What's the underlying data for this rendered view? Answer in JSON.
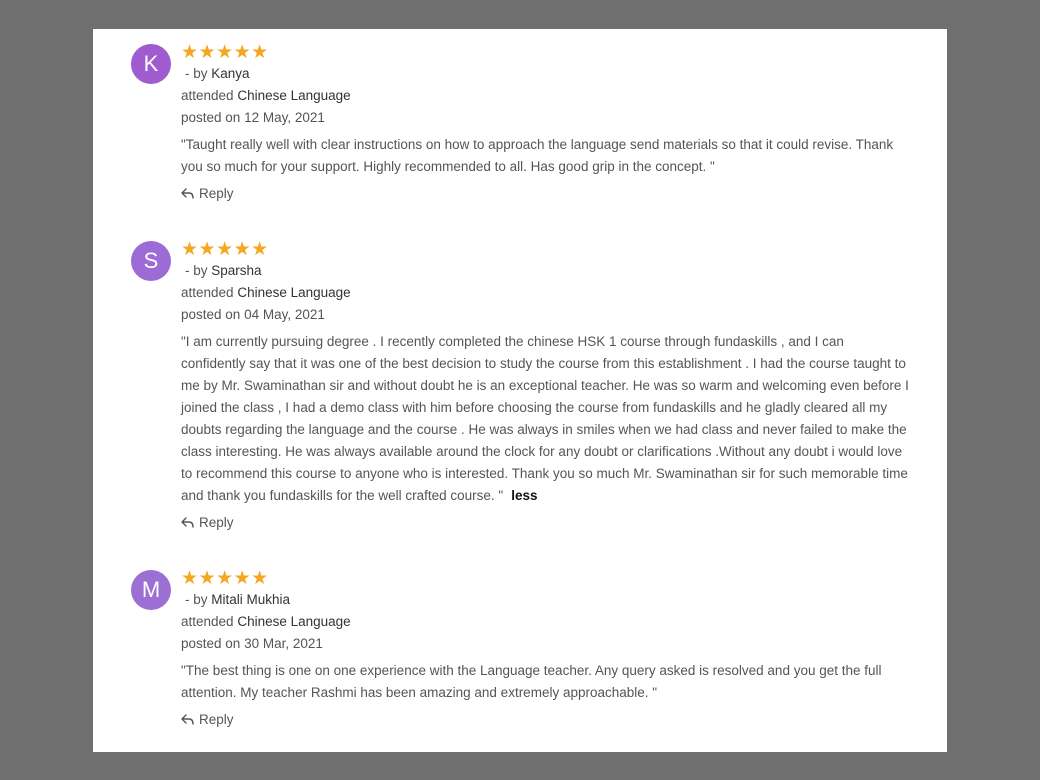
{
  "reviews": [
    {
      "initial": "K",
      "avatar_color": "#a05ccf",
      "rating": 5,
      "stars": "★★★★★",
      "by_prefix": "- by",
      "name": "Kanya",
      "attended_prefix": "attended",
      "course": "Chinese Language",
      "posted_prefix": "posted on",
      "date": "12 May, 2021",
      "text": "\"Taught really well with clear instructions on how to approach the language send materials so that it could revise. Thank you so much for your support. Highly recommended to all. Has good grip in the concept. \"",
      "reply_label": "Reply"
    },
    {
      "initial": "S",
      "avatar_color": "#9d6bd6",
      "rating": 5,
      "stars": "★★★★★",
      "by_prefix": "- by",
      "name": "Sparsha",
      "attended_prefix": "attended",
      "course": "Chinese Language",
      "posted_prefix": "posted on",
      "date": "04 May, 2021",
      "text": "\"I am currently pursuing degree . I recently completed the chinese HSK 1 course through fundaskills , and I can confidently say that it was one of the best decision to study the course from this establishment . I had the course taught to me by Mr. Swaminathan sir and without doubt he is an exceptional teacher. He was so warm and welcoming even before I joined the class , I had a demo class with him before choosing the course from fundaskills and he gladly cleared all my doubts regarding the language and the course . He was always in smiles when we had class and never failed to make the class interesting. He was always available around the clock for any doubt or clarifications .Without any doubt i would love to recommend this course to anyone who is interested. Thank you so much Mr. Swaminathan sir for such memorable time and thank you fundaskills for the well crafted course. \"",
      "less_label": "less",
      "reply_label": "Reply"
    },
    {
      "initial": "M",
      "avatar_color": "#9c6fd4",
      "rating": 5,
      "stars": "★★★★★",
      "by_prefix": "- by",
      "name": "Mitali Mukhia",
      "attended_prefix": "attended",
      "course": "Chinese Language",
      "posted_prefix": "posted on",
      "date": "30 Mar, 2021",
      "text": "\"The best thing is one on one experience with the Language teacher. Any query asked is resolved and you get the full attention. My teacher Rashmi has been amazing and extremely approachable. \"",
      "reply_label": "Reply"
    }
  ],
  "colors": {
    "star": "#f5a623",
    "backdrop": "#6f6f6f",
    "panel": "#ffffff"
  },
  "icons": {
    "reply": "reply-arrow-icon"
  }
}
